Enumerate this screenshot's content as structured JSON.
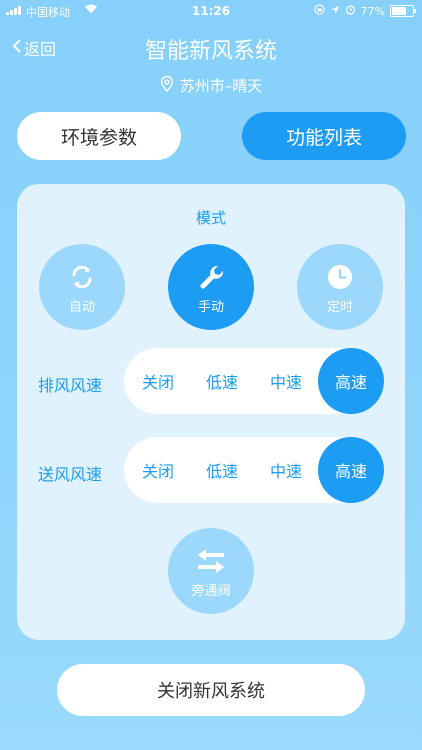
{
  "status": {
    "carrier": "中国移动",
    "time": "11:26",
    "battery": "77%",
    "battery_level": 0.77
  },
  "nav": {
    "back_label": "返回",
    "title": "智能新风系统",
    "location": "苏州市–晴天"
  },
  "tabs": [
    {
      "label": "环境参数",
      "selected": false
    },
    {
      "label": "功能列表",
      "selected": true
    }
  ],
  "mode": {
    "label": "模式",
    "buttons": [
      {
        "label": "自动",
        "icon": "refresh-icon",
        "active": false
      },
      {
        "label": "手动",
        "icon": "wrench-icon",
        "active": true
      },
      {
        "label": "定时",
        "icon": "clock-icon",
        "active": false
      }
    ]
  },
  "exhaust": {
    "label": "排风风速",
    "options": [
      "关闭",
      "低速",
      "中速",
      "高速"
    ],
    "selected": "高速"
  },
  "supply": {
    "label": "送风风速",
    "options": [
      "关闭",
      "低速",
      "中速",
      "高速"
    ],
    "selected": "高速"
  },
  "bypass": {
    "label": "旁通阀",
    "icon": "swap-arrows-icon"
  },
  "close_button": "关闭新风系统",
  "colors": {
    "accent": "#1c9cf2",
    "background": "#86d0fb",
    "panel": "#dff2fd",
    "inactive": "#9cd8fb"
  }
}
